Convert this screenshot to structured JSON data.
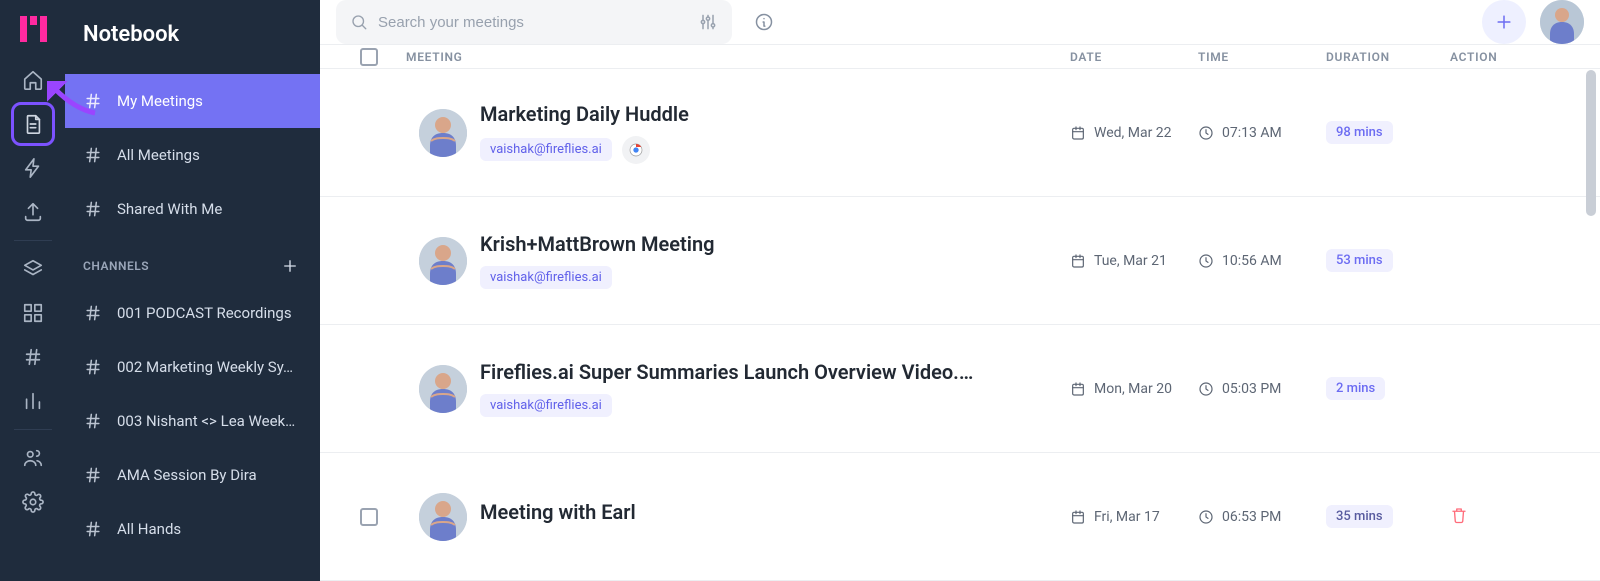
{
  "sidebar": {
    "title": "Notebook",
    "nav": [
      {
        "label": "My Meetings",
        "selected": true
      },
      {
        "label": "All Meetings",
        "selected": false
      },
      {
        "label": "Shared With Me",
        "selected": false
      }
    ],
    "channels_header": "CHANNELS",
    "channels": [
      {
        "label": "001 PODCAST Recordings"
      },
      {
        "label": "002 Marketing Weekly Sy…"
      },
      {
        "label": "003 Nishant <> Lea Week…"
      },
      {
        "label": "AMA Session By Dira"
      },
      {
        "label": "All Hands"
      }
    ]
  },
  "search": {
    "placeholder": "Search your meetings"
  },
  "columns": {
    "meeting": "MEETING",
    "date": "DATE",
    "time": "TIME",
    "duration": "DURATION",
    "action": "ACTION"
  },
  "rows": [
    {
      "title": "Marketing Daily Huddle",
      "email": "vaishak@fireflies.ai",
      "source_icon": "chrome-icon",
      "date": "Wed, Mar 22",
      "time": "07:13 AM",
      "duration": "98 mins",
      "show_check": false,
      "show_action": false,
      "dur_class": "pill"
    },
    {
      "title": "Krish+MattBrown Meeting",
      "email": "vaishak@fireflies.ai",
      "source_icon": "",
      "date": "Tue, Mar 21",
      "time": "10:56 AM",
      "duration": "53 mins",
      "show_check": false,
      "show_action": false,
      "dur_class": "pill"
    },
    {
      "title": "Fireflies.ai Super Summaries Launch Overview Video.…",
      "email": "vaishak@fireflies.ai",
      "source_icon": "",
      "date": "Mon, Mar 20",
      "time": "05:03 PM",
      "duration": "2 mins",
      "show_check": false,
      "show_action": false,
      "dur_class": "pill"
    },
    {
      "title": "Meeting with Earl",
      "email": "",
      "source_icon": "",
      "date": "Fri, Mar 17",
      "time": "06:53 PM",
      "duration": "35 mins",
      "show_check": true,
      "show_action": true,
      "dur_class": "pill dim"
    }
  ]
}
